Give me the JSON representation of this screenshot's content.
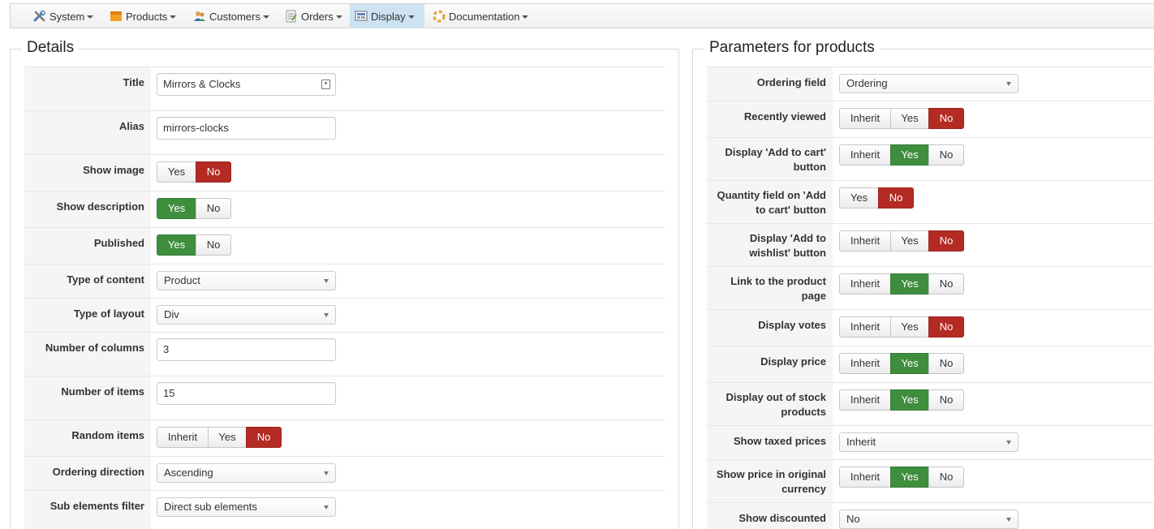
{
  "menu": [
    {
      "label": "System",
      "icon": "tools-icon"
    },
    {
      "label": "Products",
      "icon": "box-icon"
    },
    {
      "label": "Customers",
      "icon": "users-icon"
    },
    {
      "label": "Orders",
      "icon": "orders-icon"
    },
    {
      "label": "Display",
      "icon": "display-icon"
    },
    {
      "label": "Documentation",
      "icon": "lifebuoy-icon"
    }
  ],
  "details": {
    "legend": "Details",
    "title_label": "Title",
    "title_value": "Mirrors & Clocks",
    "alias_label": "Alias",
    "alias_value": "mirrors-clocks",
    "show_image_label": "Show image",
    "show_description_label": "Show description",
    "published_label": "Published",
    "type_content_label": "Type of content",
    "type_content_value": "Product",
    "type_layout_label": "Type of layout",
    "type_layout_value": "Div",
    "num_columns_label": "Number of columns",
    "num_columns_value": "3",
    "num_items_label": "Number of items",
    "num_items_value": "15",
    "random_items_label": "Random items",
    "ordering_direction_label": "Ordering direction",
    "ordering_direction_value": "Ascending",
    "sub_elements_label": "Sub elements filter",
    "sub_elements_value": "Direct sub elements"
  },
  "buttons": {
    "inherit": "Inherit",
    "yes": "Yes",
    "no": "No"
  },
  "params": {
    "legend": "Parameters for products",
    "ordering_field_label": "Ordering field",
    "ordering_field_value": "Ordering",
    "recently_viewed_label": "Recently viewed",
    "add_to_cart_label_1": "Display 'Add to cart'",
    "add_to_cart_label_2": "button",
    "quantity_label_1": "Quantity field on 'Add",
    "quantity_label_2": "to cart' button",
    "wishlist_label_1": "Display 'Add to",
    "wishlist_label_2": "wishlist' button",
    "link_product_label_1": "Link to the product",
    "link_product_label_2": "page",
    "display_votes_label": "Display votes",
    "display_price_label": "Display price",
    "out_of_stock_label_1": "Display out of stock",
    "out_of_stock_label_2": "products",
    "taxed_prices_label": "Show taxed prices",
    "taxed_prices_value": "Inherit",
    "original_currency_label_1": "Show price in original",
    "original_currency_label_2": "currency",
    "discounted_label": "Show discounted",
    "discounted_value": "No"
  },
  "colors": {
    "yes_active": "#3e8e3e",
    "no_active": "#b42b24",
    "menu_active": "#cde3f1"
  }
}
